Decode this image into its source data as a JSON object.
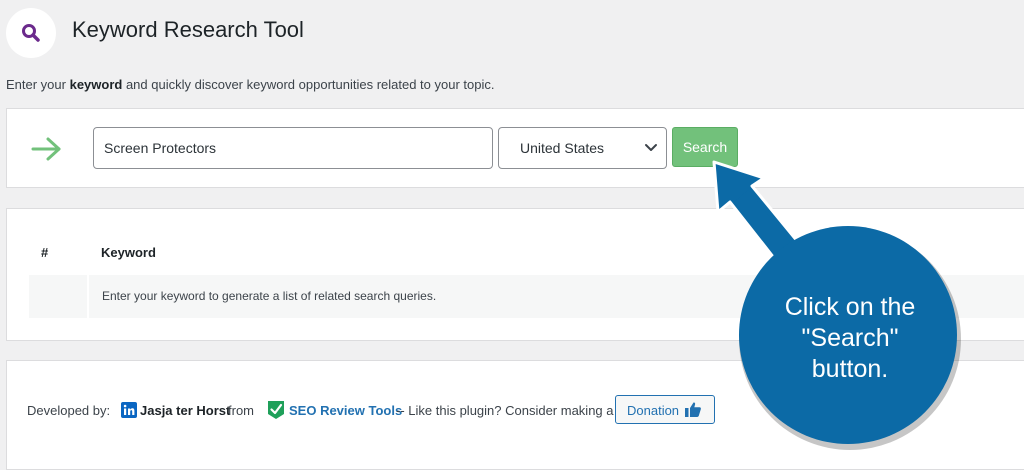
{
  "header": {
    "title": "Keyword Research Tool",
    "logo_icon": "magnifier-icon",
    "intro_prefix": "Enter your ",
    "intro_bold": "keyword",
    "intro_suffix": " and quickly discover keyword opportunities related to your topic."
  },
  "search": {
    "arrow_icon": "arrow-right-icon",
    "keyword_value": "Screen Protectors",
    "country_value": "United States",
    "button_label": "Search"
  },
  "results": {
    "columns": [
      "#",
      "Keyword"
    ],
    "empty_message": "Enter your keyword to generate a list of related search queries."
  },
  "footer": {
    "developed_by": "Developed by:",
    "author": "Jasja ter Horst",
    "from": "from",
    "seo_link": "SEO Review Tools",
    "like_text": "-- Like this plugin? Consider making a",
    "donation_label": "Donation"
  },
  "callout": {
    "line1": "Click on the",
    "line2": "\"Search\"",
    "line3": "button."
  },
  "colors": {
    "accent_green": "#72c17b",
    "link_blue": "#2271b1",
    "callout_blue": "#0c6aa6",
    "logo_purple": "#6b2a8c"
  }
}
